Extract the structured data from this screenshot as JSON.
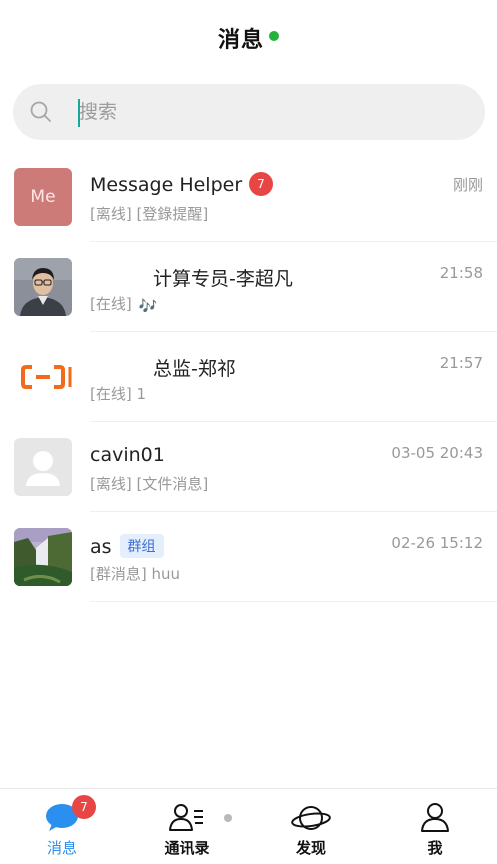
{
  "header": {
    "title": "消息",
    "status_color": "#21b33a"
  },
  "search": {
    "placeholder": "搜索"
  },
  "conversations": [
    {
      "avatar_text": "Me",
      "name": "Message Helper",
      "badge": "7",
      "status": "[离线]",
      "preview": "[登錄提醒]",
      "time": "刚刚"
    },
    {
      "avatar_icon": "person-photo-icon",
      "name": "计算专员-李超凡",
      "status": "[在线]",
      "preview": "🎶",
      "time": "21:58"
    },
    {
      "avatar_icon": "aliyun-logo-icon",
      "name": "总监-郑祁",
      "status": "[在线]",
      "preview": "1",
      "time": "21:57"
    },
    {
      "avatar_icon": "default-user-icon",
      "name": "cavin01",
      "status": "[离线]",
      "preview": "[文件消息]",
      "time": "03-05 20:43"
    },
    {
      "avatar_icon": "waterfall-photo-icon",
      "name": "as",
      "tag": "群组",
      "status": "[群消息]",
      "preview": "huu",
      "time": "02-26 15:12"
    }
  ],
  "tabbar": {
    "items": [
      {
        "label": "消息",
        "icon": "chat-bubble-icon",
        "badge": "7",
        "active": true
      },
      {
        "label": "通讯录",
        "icon": "contacts-icon"
      },
      {
        "label": "发现",
        "icon": "planet-icon"
      },
      {
        "label": "我",
        "icon": "person-icon"
      }
    ]
  },
  "colors": {
    "accent": "#2b8ff0",
    "badge": "#e84545",
    "tag_bg": "#e5eefc",
    "tag_text": "#3d6fd1"
  }
}
